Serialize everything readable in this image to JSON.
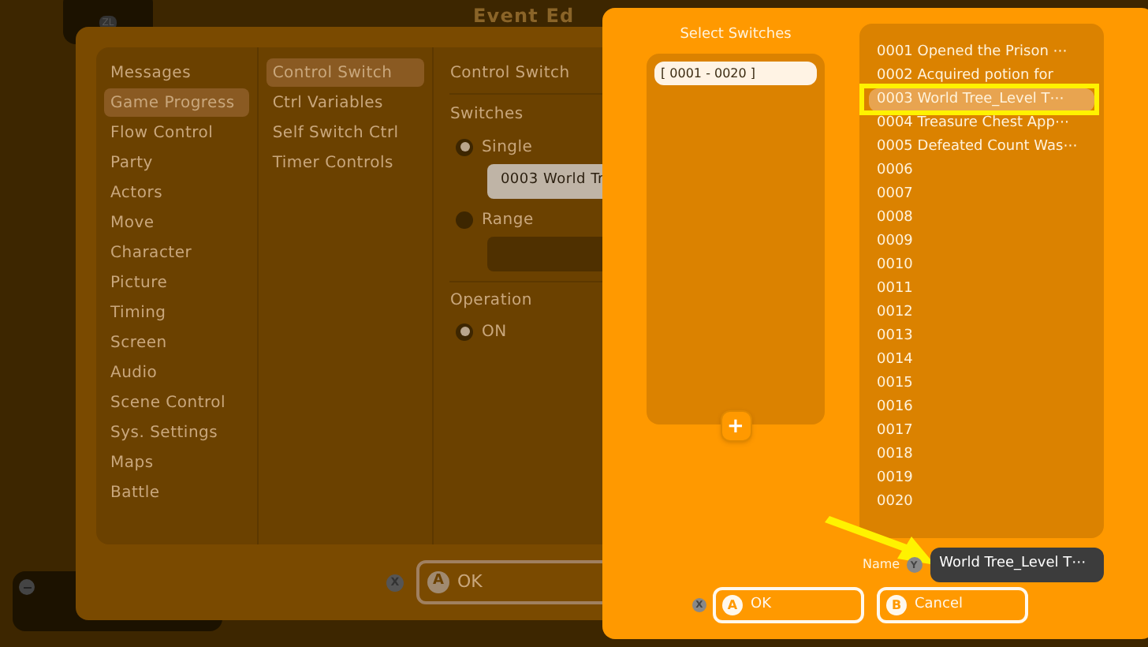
{
  "back_window": {
    "title": "Event Ed",
    "categories": [
      {
        "label": "Messages",
        "selected": false
      },
      {
        "label": "Game Progress",
        "selected": true
      },
      {
        "label": "Flow Control",
        "selected": false
      },
      {
        "label": "Party",
        "selected": false
      },
      {
        "label": "Actors",
        "selected": false
      },
      {
        "label": "Move",
        "selected": false
      },
      {
        "label": "Character",
        "selected": false
      },
      {
        "label": "Picture",
        "selected": false
      },
      {
        "label": "Timing",
        "selected": false
      },
      {
        "label": "Screen",
        "selected": false
      },
      {
        "label": "Audio",
        "selected": false
      },
      {
        "label": "Scene Control",
        "selected": false
      },
      {
        "label": "Sys. Settings",
        "selected": false
      },
      {
        "label": "Maps",
        "selected": false
      },
      {
        "label": "Battle",
        "selected": false
      }
    ],
    "commands": [
      {
        "label": "Control Switch",
        "selected": true
      },
      {
        "label": "Ctrl Variables",
        "selected": false
      },
      {
        "label": "Self Switch Ctrl",
        "selected": false
      },
      {
        "label": "Timer Controls",
        "selected": false
      }
    ],
    "detail": {
      "heading": "Control Switch",
      "switches_label": "Switches",
      "options": [
        {
          "label": "Single",
          "selected": true,
          "value": "0003 World Tr"
        },
        {
          "label": "Range",
          "selected": false
        }
      ],
      "operation_label": "Operation",
      "operation": [
        {
          "label": "ON",
          "selected": true
        }
      ]
    },
    "footer": {
      "x_key": "X",
      "ok_key": "A",
      "ok": "OK"
    }
  },
  "top_tab_key": "ZL",
  "dialog": {
    "select_title": "Select Switches",
    "groups": [
      {
        "label": "[ 0001 - 0020 ]",
        "selected": true
      }
    ],
    "add_button": "+",
    "switches": [
      {
        "label": "0001 Opened the Prison ⋯",
        "selected": false
      },
      {
        "label": "0002 Acquired potion for",
        "selected": false
      },
      {
        "label": "0003 World Tree_Level T⋯",
        "selected": true
      },
      {
        "label": "0004 Treasure Chest App⋯",
        "selected": false
      },
      {
        "label": "0005 Defeated Count Was⋯",
        "selected": false
      },
      {
        "label": "0006",
        "selected": false
      },
      {
        "label": "0007",
        "selected": false
      },
      {
        "label": "0008",
        "selected": false
      },
      {
        "label": "0009",
        "selected": false
      },
      {
        "label": "0010",
        "selected": false
      },
      {
        "label": "0011",
        "selected": false
      },
      {
        "label": "0012",
        "selected": false
      },
      {
        "label": "0013",
        "selected": false
      },
      {
        "label": "0014",
        "selected": false
      },
      {
        "label": "0015",
        "selected": false
      },
      {
        "label": "0016",
        "selected": false
      },
      {
        "label": "0017",
        "selected": false
      },
      {
        "label": "0018",
        "selected": false
      },
      {
        "label": "0019",
        "selected": false
      },
      {
        "label": "0020",
        "selected": false
      }
    ],
    "name_label": "Name",
    "name_key": "Y",
    "name_value": "World Tree_Level T⋯",
    "x_key": "X",
    "buttons": [
      {
        "key": "A",
        "label": "OK"
      },
      {
        "key": "B",
        "label": "Cancel"
      }
    ]
  }
}
